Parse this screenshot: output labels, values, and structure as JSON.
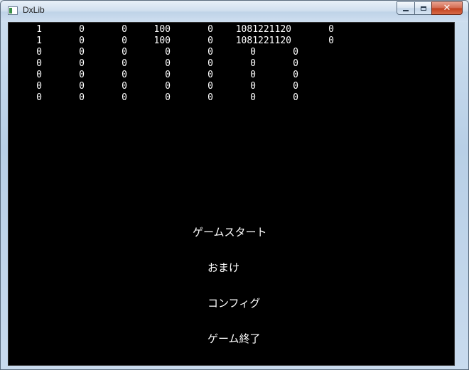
{
  "window": {
    "title": "DxLib",
    "close_glyph": "✕"
  },
  "debug_rows": [
    [
      "1",
      "0",
      "0",
      "100",
      "0",
      "1081221120",
      "0"
    ],
    [
      "1",
      "0",
      "0",
      "100",
      "0",
      "1081221120",
      "0"
    ],
    [
      "0",
      "0",
      "0",
      "0",
      "0",
      "0",
      "0"
    ],
    [
      "0",
      "0",
      "0",
      "0",
      "0",
      "0",
      "0"
    ],
    [
      "0",
      "0",
      "0",
      "0",
      "0",
      "0",
      "0"
    ],
    [
      "0",
      "0",
      "0",
      "0",
      "0",
      "0",
      "0"
    ],
    [
      "0",
      "0",
      "0",
      "0",
      "0",
      "0",
      "0"
    ]
  ],
  "menu": {
    "items": [
      {
        "label": "ゲームスタート"
      },
      {
        "label": "おまけ"
      },
      {
        "label": "コンフィグ"
      },
      {
        "label": "ゲーム終了"
      }
    ]
  }
}
